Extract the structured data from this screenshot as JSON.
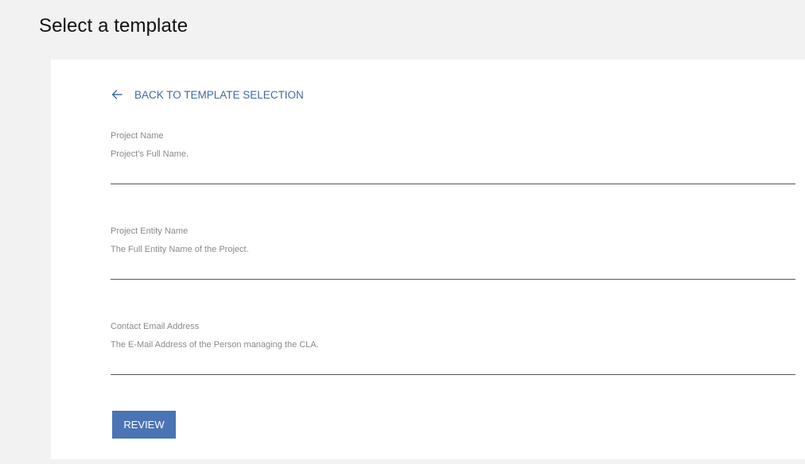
{
  "header": {
    "title": "Select a template"
  },
  "form": {
    "back_label": "BACK TO TEMPLATE SELECTION",
    "fields": [
      {
        "label": "Project Name",
        "placeholder": "Project's Full Name.",
        "value": ""
      },
      {
        "label": "Project Entity Name",
        "placeholder": "The Full Entity Name of the Project.",
        "value": ""
      },
      {
        "label": "Contact Email Address",
        "placeholder": "The E-Mail Address of the Person managing the CLA.",
        "value": ""
      }
    ],
    "submit_label": "REVIEW"
  },
  "colors": {
    "accent": "#4a74b4",
    "link": "#3e6aa6",
    "background": "#f1f2f1"
  },
  "icons": {
    "back": "arrow-left-icon"
  }
}
